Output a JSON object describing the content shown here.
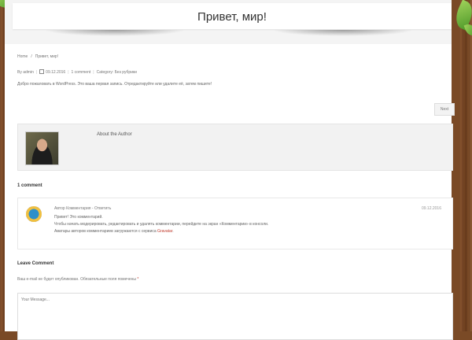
{
  "post": {
    "title": "Привет, мир!",
    "body": "Добро пожаловать в WordPress. Это ваша первая запись. Отредактируйте или удалите её, затем пишите!"
  },
  "breadcrumb": {
    "home": "Home",
    "separator": "/",
    "current": "Привет, мир!"
  },
  "meta": {
    "by_label": "By",
    "author": "admin",
    "date": "09.12.2016",
    "comments": "1 comment",
    "category_label": "Category:",
    "category": "Без рубрики"
  },
  "navigation": {
    "next_label": "Next"
  },
  "author_box": {
    "title": "About the Author"
  },
  "comments": {
    "heading": "1 comment",
    "items": [
      {
        "author": "Автор Комментария",
        "separator": " - ",
        "reply": "Ответить",
        "date": "09.12.2016",
        "line1": "Привет! Это комментарий.",
        "line2": "Чтобы начать модерировать, редактировать и удалять комментарии, перейдите на экран «Комментарии» в консоли.",
        "line3_pre": "Аватары авторов комментариев загружаются с сервиса",
        "line3_link": "Gravatar",
        "line3_post": "."
      }
    ]
  },
  "leave_comment": {
    "heading": "Leave Comment",
    "note": "Ваш e-mail не будет опубликован. Обязательные поля помечены",
    "required_mark": "*",
    "message_placeholder": "Your Message..."
  }
}
